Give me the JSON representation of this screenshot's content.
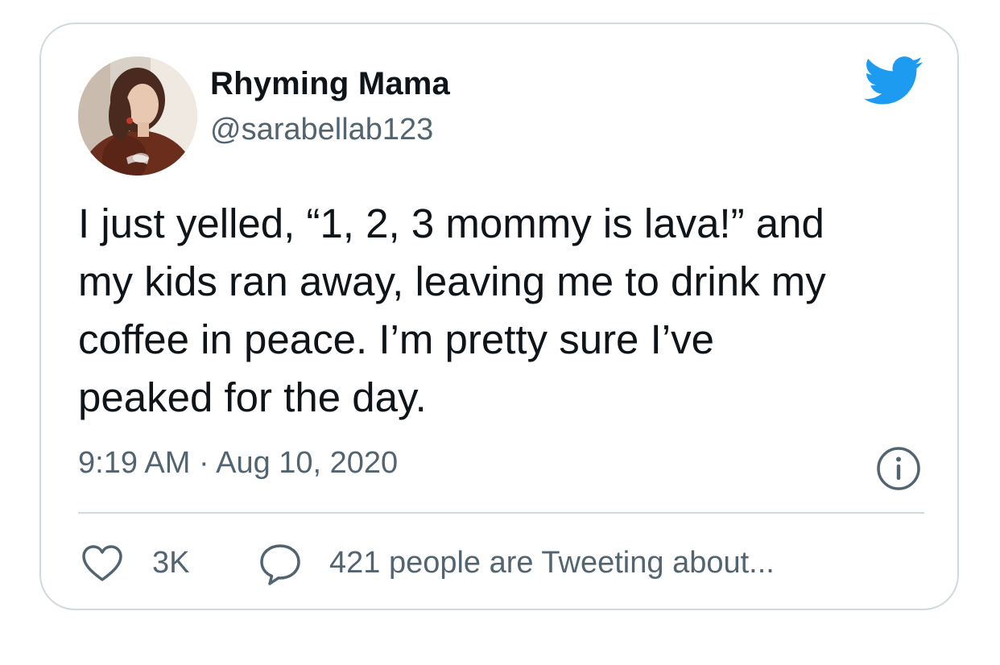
{
  "author": {
    "display_name": "Rhyming Mama",
    "handle": "@sarabellab123"
  },
  "tweet": {
    "text_lines": [
      "I just yelled, “1, 2, 3 mommy is lava!” and",
      "my kids ran away, leaving me to drink my",
      "coffee in peace. I’m pretty sure I’ve",
      "peaked for the day."
    ],
    "timestamp": "9:19 AM · Aug 10, 2020"
  },
  "actions": {
    "like_count": "3K",
    "discussion_label": "421 people are Tweeting about..."
  },
  "icons": {
    "brand": "twitter-bird-icon",
    "info": "info-icon",
    "like": "heart-icon",
    "reply": "speech-bubble-icon"
  },
  "colors": {
    "brand": "#1d9bf0",
    "text_primary": "#0f1419",
    "text_secondary": "#536471",
    "border": "#cfd9de"
  }
}
